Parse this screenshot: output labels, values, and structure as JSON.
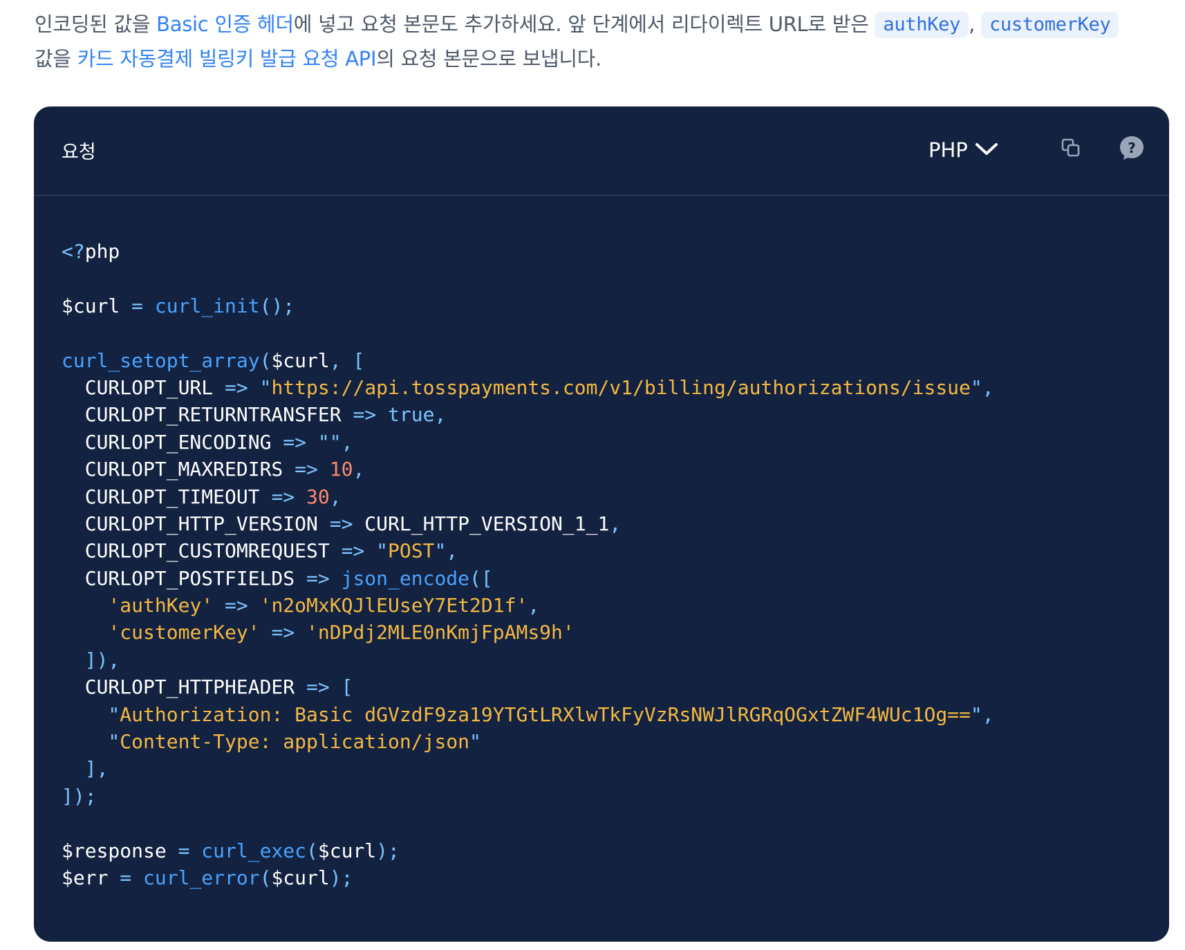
{
  "intro": {
    "line1_start": "인코딩된 값을 ",
    "link_basic_auth": "Basic 인증 헤더",
    "line1_mid": "에 넣고 요청 본문도 추가하세요. 앞 단계에서 리다이렉트 URL로 받은 ",
    "chip_authkey": "authKey",
    "comma": ", ",
    "chip_customerkey": "customerKey",
    "line2_start": "값을 ",
    "link_billing_api": "카드 자동결제 빌링키 발급 요청 API",
    "line2_end": "의 요청 본문으로 보냅니다."
  },
  "card": {
    "title": "요청",
    "language": "PHP",
    "icons": {
      "dropdown": "chevron-down-icon",
      "copy": "copy-icon",
      "help": "help-icon"
    }
  },
  "code": {
    "lines": [
      [
        {
          "t": "tag",
          "v": "<?"
        },
        {
          "t": "plain",
          "v": "php"
        }
      ],
      [],
      [
        {
          "t": "plain",
          "v": "$curl "
        },
        {
          "t": "op",
          "v": "="
        },
        {
          "t": "plain",
          "v": " "
        },
        {
          "t": "fn",
          "v": "curl_init"
        },
        {
          "t": "punc",
          "v": "();"
        }
      ],
      [],
      [
        {
          "t": "fn",
          "v": "curl_setopt_array"
        },
        {
          "t": "punc",
          "v": "("
        },
        {
          "t": "plain",
          "v": "$curl"
        },
        {
          "t": "punc",
          "v": ", ["
        }
      ],
      [
        {
          "t": "plain",
          "v": "  CURLOPT_URL "
        },
        {
          "t": "op",
          "v": "=>"
        },
        {
          "t": "plain",
          "v": " "
        },
        {
          "t": "punc",
          "v": "\""
        },
        {
          "t": "str",
          "v": "https://api.tosspayments.com/v1/billing/authorizations/issue"
        },
        {
          "t": "punc",
          "v": "\","
        }
      ],
      [
        {
          "t": "plain",
          "v": "  CURLOPT_RETURNTRANSFER "
        },
        {
          "t": "op",
          "v": "=>"
        },
        {
          "t": "plain",
          "v": " "
        },
        {
          "t": "kw",
          "v": "true"
        },
        {
          "t": "punc",
          "v": ","
        }
      ],
      [
        {
          "t": "plain",
          "v": "  CURLOPT_ENCODING "
        },
        {
          "t": "op",
          "v": "=>"
        },
        {
          "t": "plain",
          "v": " "
        },
        {
          "t": "punc",
          "v": "\"\","
        }
      ],
      [
        {
          "t": "plain",
          "v": "  CURLOPT_MAXREDIRS "
        },
        {
          "t": "op",
          "v": "=>"
        },
        {
          "t": "plain",
          "v": " "
        },
        {
          "t": "num",
          "v": "10"
        },
        {
          "t": "punc",
          "v": ","
        }
      ],
      [
        {
          "t": "plain",
          "v": "  CURLOPT_TIMEOUT "
        },
        {
          "t": "op",
          "v": "=>"
        },
        {
          "t": "plain",
          "v": " "
        },
        {
          "t": "num",
          "v": "30"
        },
        {
          "t": "punc",
          "v": ","
        }
      ],
      [
        {
          "t": "plain",
          "v": "  CURLOPT_HTTP_VERSION "
        },
        {
          "t": "op",
          "v": "=>"
        },
        {
          "t": "plain",
          "v": " CURL_HTTP_VERSION_1_1"
        },
        {
          "t": "punc",
          "v": ","
        }
      ],
      [
        {
          "t": "plain",
          "v": "  CURLOPT_CUSTOMREQUEST "
        },
        {
          "t": "op",
          "v": "=>"
        },
        {
          "t": "plain",
          "v": " "
        },
        {
          "t": "punc",
          "v": "\""
        },
        {
          "t": "str",
          "v": "POST"
        },
        {
          "t": "punc",
          "v": "\","
        }
      ],
      [
        {
          "t": "plain",
          "v": "  CURLOPT_POSTFIELDS "
        },
        {
          "t": "op",
          "v": "=>"
        },
        {
          "t": "plain",
          "v": " "
        },
        {
          "t": "fn",
          "v": "json_encode"
        },
        {
          "t": "punc",
          "v": "(["
        }
      ],
      [
        {
          "t": "plain",
          "v": "    "
        },
        {
          "t": "str",
          "v": "'authKey'"
        },
        {
          "t": "plain",
          "v": " "
        },
        {
          "t": "op",
          "v": "=>"
        },
        {
          "t": "plain",
          "v": " "
        },
        {
          "t": "str",
          "v": "'n2oMxKQJlEUseY7Et2D1f'"
        },
        {
          "t": "punc",
          "v": ","
        }
      ],
      [
        {
          "t": "plain",
          "v": "    "
        },
        {
          "t": "str",
          "v": "'customerKey'"
        },
        {
          "t": "plain",
          "v": " "
        },
        {
          "t": "op",
          "v": "=>"
        },
        {
          "t": "plain",
          "v": " "
        },
        {
          "t": "str",
          "v": "'nDPdj2MLE0nKmjFpAMs9h'"
        }
      ],
      [
        {
          "t": "punc",
          "v": "  ]),"
        }
      ],
      [
        {
          "t": "plain",
          "v": "  CURLOPT_HTTPHEADER "
        },
        {
          "t": "op",
          "v": "=>"
        },
        {
          "t": "plain",
          "v": " "
        },
        {
          "t": "punc",
          "v": "["
        }
      ],
      [
        {
          "t": "plain",
          "v": "    "
        },
        {
          "t": "punc",
          "v": "\""
        },
        {
          "t": "str",
          "v": "Authorization: Basic dGVzdF9za19YTGtLRXlwTkFyVzRsNWJlRGRqOGxtZWF4WUc1Og=="
        },
        {
          "t": "punc",
          "v": "\","
        }
      ],
      [
        {
          "t": "plain",
          "v": "    "
        },
        {
          "t": "punc",
          "v": "\""
        },
        {
          "t": "str",
          "v": "Content-Type: application/json"
        },
        {
          "t": "punc",
          "v": "\""
        }
      ],
      [
        {
          "t": "punc",
          "v": "  ],"
        }
      ],
      [
        {
          "t": "punc",
          "v": "]);"
        }
      ],
      [],
      [
        {
          "t": "plain",
          "v": "$response "
        },
        {
          "t": "op",
          "v": "="
        },
        {
          "t": "plain",
          "v": " "
        },
        {
          "t": "fn",
          "v": "curl_exec"
        },
        {
          "t": "punc",
          "v": "("
        },
        {
          "t": "plain",
          "v": "$curl"
        },
        {
          "t": "punc",
          "v": ");"
        }
      ],
      [
        {
          "t": "plain",
          "v": "$err "
        },
        {
          "t": "op",
          "v": "="
        },
        {
          "t": "plain",
          "v": " "
        },
        {
          "t": "fn",
          "v": "curl_error"
        },
        {
          "t": "punc",
          "v": "("
        },
        {
          "t": "plain",
          "v": "$curl"
        },
        {
          "t": "punc",
          "v": ");"
        }
      ]
    ]
  }
}
